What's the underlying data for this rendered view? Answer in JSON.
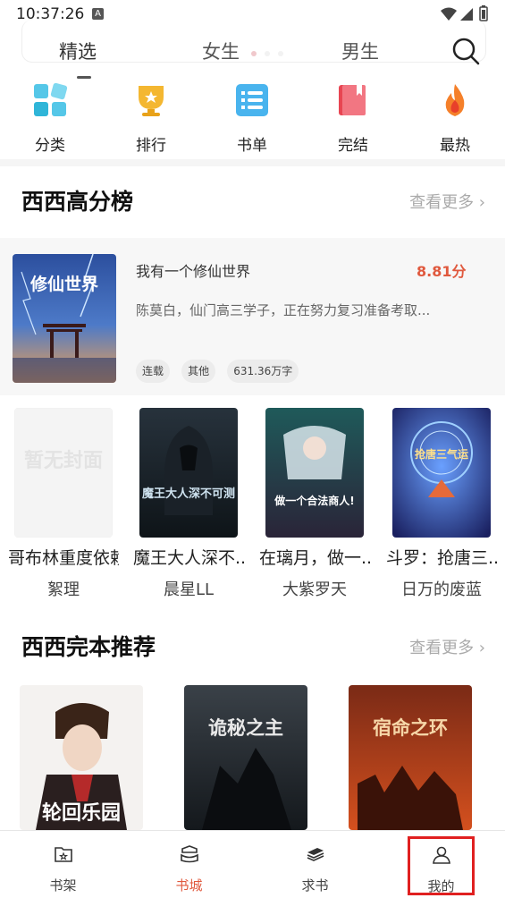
{
  "status_bar": {
    "time": "10:37:26",
    "notification_badge": "A"
  },
  "top_tabs": [
    {
      "label": "精选",
      "active": true
    },
    {
      "label": "女生",
      "active": false
    },
    {
      "label": "男生",
      "active": false
    }
  ],
  "categories": [
    {
      "label": "分类",
      "icon": "grid-icon"
    },
    {
      "label": "排行",
      "icon": "trophy-icon"
    },
    {
      "label": "书单",
      "icon": "list-icon"
    },
    {
      "label": "完结",
      "icon": "book-icon"
    },
    {
      "label": "最热",
      "icon": "fire-icon"
    }
  ],
  "section_high_score": {
    "title": "西西高分榜",
    "more": "查看更多 ›",
    "featured": {
      "cover_text": "修仙世界",
      "title": "我有一个修仙世界",
      "score": "8.81分",
      "description": "陈莫白，仙门高三学子，正在努力复习准备考取...",
      "tags": [
        "连载",
        "其他",
        "631.36万字"
      ]
    },
    "books": [
      {
        "name": "哥布林重度依赖",
        "author": "絮理",
        "cover_text": "暂无封面"
      },
      {
        "name": "魔王大人深不...",
        "author": "晨星LL",
        "cover_text": "魔王大人深不可测"
      },
      {
        "name": "在璃月，做一...",
        "author": "大紫罗天",
        "cover_text": "做一个合法商人!"
      },
      {
        "name": "斗罗：抢唐三...",
        "author": "日万的废蓝",
        "cover_text": "抢唐三气运"
      }
    ]
  },
  "section_complete": {
    "title": "西西完本推荐",
    "more": "查看更多 ›",
    "covers": [
      "轮回乐园",
      "诡秘之主",
      "宿命之环"
    ]
  },
  "bottom_nav": [
    {
      "label": "书架",
      "icon": "bookshelf-icon",
      "active": false
    },
    {
      "label": "书城",
      "icon": "bookstore-icon",
      "active": true
    },
    {
      "label": "求书",
      "icon": "request-book-icon",
      "active": false
    },
    {
      "label": "我的",
      "icon": "profile-icon",
      "active": false
    }
  ],
  "colors": {
    "accent": "#e0593e",
    "highlight_box": "#e02020"
  }
}
